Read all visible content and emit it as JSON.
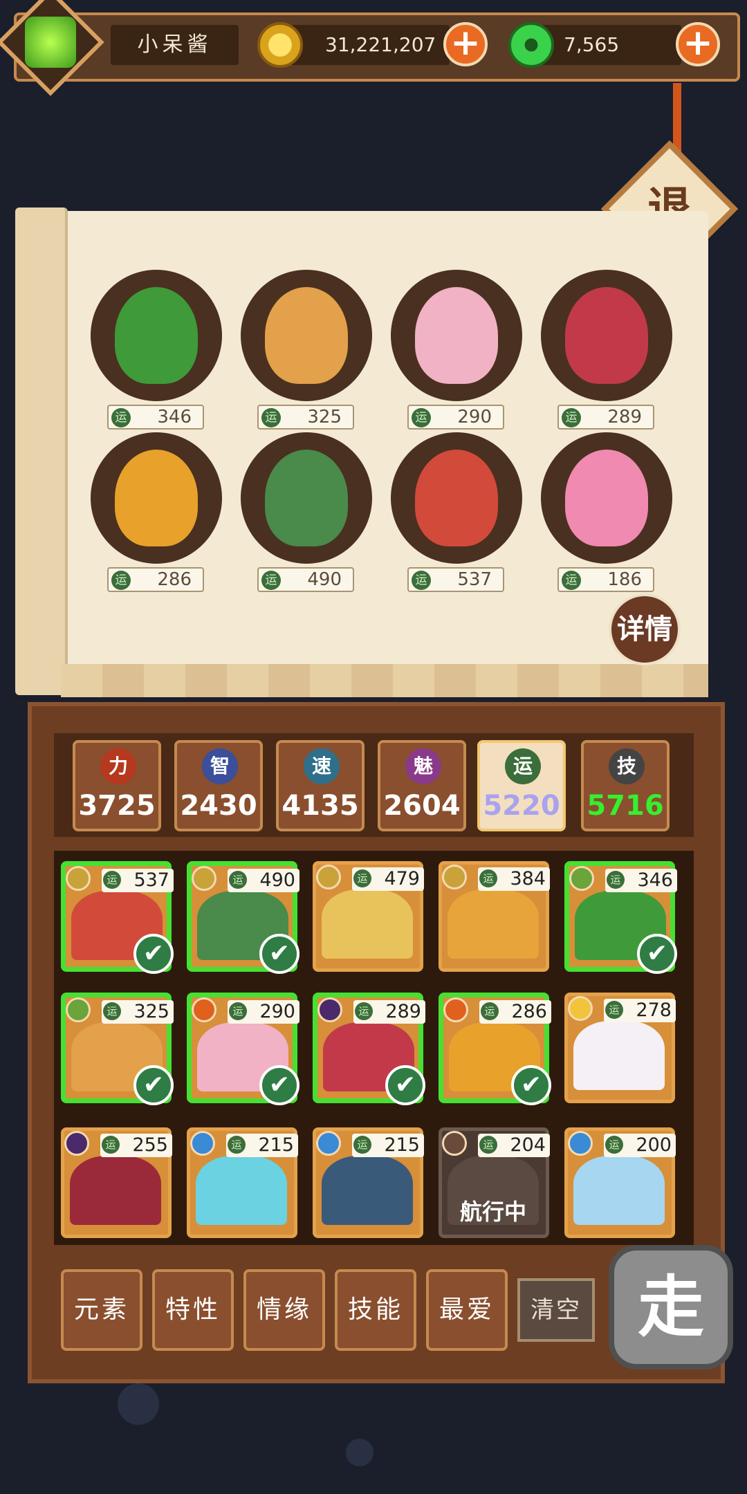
{
  "player": {
    "name": "小呆酱",
    "gold": "31,221,207",
    "jade": "7,565"
  },
  "buttons": {
    "exit": "退",
    "detail": "详情",
    "go": "走",
    "clear": "清空"
  },
  "selected_heroes": [
    {
      "luck": "346",
      "color": "#3f9a3a"
    },
    {
      "luck": "325",
      "color": "#e2a14a"
    },
    {
      "luck": "290",
      "color": "#f0b2c4"
    },
    {
      "luck": "289",
      "color": "#c23a4a"
    },
    {
      "luck": "286",
      "color": "#e8a12a"
    },
    {
      "luck": "490",
      "color": "#4a8a4a"
    },
    {
      "luck": "537",
      "color": "#d24a3a"
    },
    {
      "luck": "186",
      "color": "#f08ab0"
    }
  ],
  "stats": [
    {
      "label": "力",
      "value": "3725",
      "badge_color": "#b5391e",
      "value_color": "#ffffff"
    },
    {
      "label": "智",
      "value": "2430",
      "badge_color": "#3b4f9a",
      "value_color": "#ffffff"
    },
    {
      "label": "速",
      "value": "4135",
      "badge_color": "#2f6f8a",
      "value_color": "#ffffff"
    },
    {
      "label": "魅",
      "value": "2604",
      "badge_color": "#8a3a8a",
      "value_color": "#ffffff"
    },
    {
      "label": "运",
      "value": "5220",
      "badge_color": "#3b6e3a",
      "value_color": "#a9a2ee"
    },
    {
      "label": "技",
      "value": "5716",
      "badge_color": "#444444",
      "value_color": "#35f02f"
    }
  ],
  "roster": [
    {
      "luck": "537",
      "selected": true,
      "elem": "#c9a33a",
      "color": "#d24a3a"
    },
    {
      "luck": "490",
      "selected": true,
      "elem": "#c9a33a",
      "color": "#4a8a4a"
    },
    {
      "luck": "479",
      "selected": false,
      "elem": "#c9a33a",
      "color": "#e8c25a"
    },
    {
      "luck": "384",
      "selected": false,
      "elem": "#c9a33a",
      "color": "#e6a43a"
    },
    {
      "luck": "346",
      "selected": true,
      "elem": "#6aa43a",
      "color": "#3f9a3a"
    },
    {
      "luck": "325",
      "selected": true,
      "elem": "#6aa43a",
      "color": "#e2a14a"
    },
    {
      "luck": "290",
      "selected": true,
      "elem": "#e0601e",
      "color": "#f0b2c4"
    },
    {
      "luck": "289",
      "selected": true,
      "elem": "#4a2a6a",
      "color": "#c23a4a"
    },
    {
      "luck": "286",
      "selected": true,
      "elem": "#e0601e",
      "color": "#e8a12a"
    },
    {
      "luck": "278",
      "selected": false,
      "elem": "#f2c43a",
      "color": "#f4f0f6"
    },
    {
      "luck": "255",
      "selected": false,
      "elem": "#4a2a6a",
      "color": "#9a2a3a"
    },
    {
      "luck": "215",
      "selected": false,
      "elem": "#3a8ad6",
      "color": "#6ad2e0"
    },
    {
      "luck": "215",
      "selected": false,
      "elem": "#3a8ad6",
      "color": "#3a5a7a"
    },
    {
      "luck": "204",
      "selected": false,
      "elem": "#6a4a3a",
      "color": "#5a4a42",
      "status": "航行中"
    },
    {
      "luck": "200",
      "selected": false,
      "elem": "#3a8ad6",
      "color": "#a6d6f0"
    }
  ],
  "filters": [
    "元素",
    "特性",
    "情缘",
    "技能",
    "最爱"
  ]
}
